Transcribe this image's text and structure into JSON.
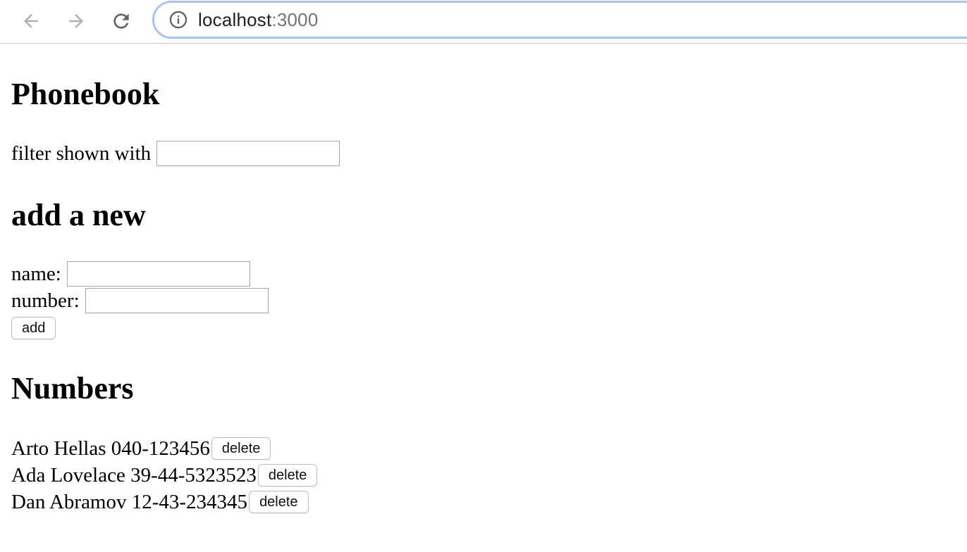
{
  "browser": {
    "url_host": "localhost",
    "url_port": ":3000",
    "icons": {
      "back": "back-arrow-icon",
      "forward": "forward-arrow-icon",
      "reload": "reload-icon",
      "info": "info-icon"
    },
    "colors": {
      "omnibox_border": "#a8c4f0",
      "nav_icon_disabled": "#b0b0b0",
      "nav_icon_enabled": "#5f6368"
    }
  },
  "page": {
    "title": "Phonebook",
    "filter": {
      "label": "filter shown with",
      "value": ""
    },
    "add_section": {
      "heading": "add a new",
      "name_label": "name:",
      "name_value": "",
      "number_label": "number:",
      "number_value": "",
      "add_button": "add"
    },
    "numbers_section": {
      "heading": "Numbers",
      "entries": [
        {
          "text": "Arto Hellas 040-123456",
          "delete_label": "delete"
        },
        {
          "text": "Ada Lovelace 39-44-5323523",
          "delete_label": "delete"
        },
        {
          "text": "Dan Abramov 12-43-234345",
          "delete_label": "delete"
        }
      ]
    }
  }
}
